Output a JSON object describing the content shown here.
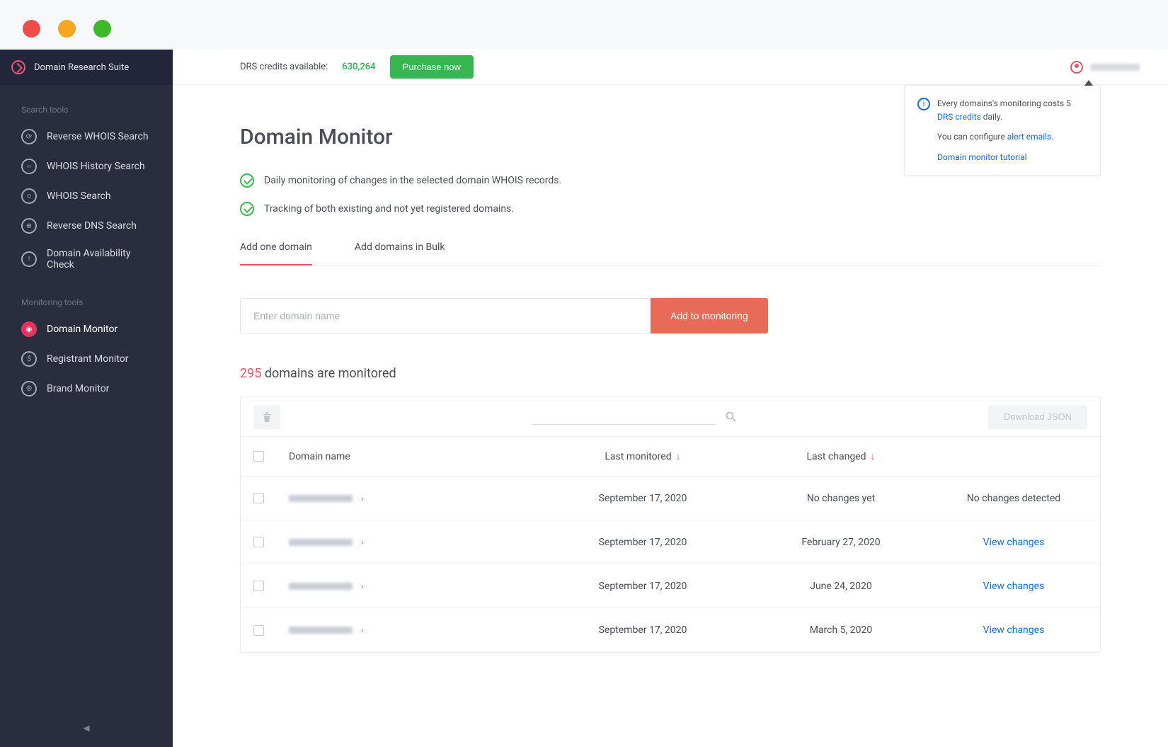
{
  "brand": "Domain Research Suite",
  "sidebar": {
    "section1": "Search tools",
    "section2": "Monitoring tools",
    "search": [
      {
        "label": "Reverse WHOIS Search",
        "glyph": "⟳"
      },
      {
        "label": "WHOIS History Search",
        "glyph": "‹›"
      },
      {
        "label": "WHOIS Search",
        "glyph": "☺"
      },
      {
        "label": "Reverse DNS Search",
        "glyph": "⊕"
      },
      {
        "label": "Domain Availability Check",
        "glyph": "!"
      }
    ],
    "monitor": [
      {
        "label": "Domain Monitor",
        "glyph": "◉"
      },
      {
        "label": "Registrant Monitor",
        "glyph": "$"
      },
      {
        "label": "Brand Monitor",
        "glyph": "®"
      }
    ]
  },
  "topbar": {
    "credits_label": "DRS credits available:",
    "credits_value": "630,264",
    "purchase": "Purchase now"
  },
  "info": {
    "line1a": "Every domains's monitoring costs 5 ",
    "line1link": "DRS credits",
    "line1b": " daily.",
    "line2a": "You can configure ",
    "line2link": "alert emails",
    "line2b": ".",
    "line3link": "Domain monitor tutorial"
  },
  "page": {
    "title": "Domain Monitor",
    "feature1": "Daily monitoring of changes in the selected domain WHOIS records.",
    "feature2": "Tracking of both existing and not yet registered domains.",
    "tab1": "Add one domain",
    "tab2": "Add domains in Bulk",
    "placeholder": "Enter domain name",
    "add_btn": "Add to monitoring",
    "count_num": "295",
    "count_rest": " domains are monitored"
  },
  "table": {
    "download": "Download JSON",
    "col_domain": "Domain name",
    "col_monitored": "Last monitored",
    "col_changed": "Last changed",
    "no_changes_yet": "No changes yet",
    "no_changes_detected": "No changes detected",
    "view_changes": "View changes",
    "rows": [
      {
        "monitored": "September 17, 2020",
        "changed": "No changes yet",
        "action": "No changes detected",
        "link": false
      },
      {
        "monitored": "September 17, 2020",
        "changed": "February 27, 2020",
        "action": "View changes",
        "link": true
      },
      {
        "monitored": "September 17, 2020",
        "changed": "June 24, 2020",
        "action": "View changes",
        "link": true
      },
      {
        "monitored": "September 17, 2020",
        "changed": "March 5, 2020",
        "action": "View changes",
        "link": true
      }
    ]
  }
}
